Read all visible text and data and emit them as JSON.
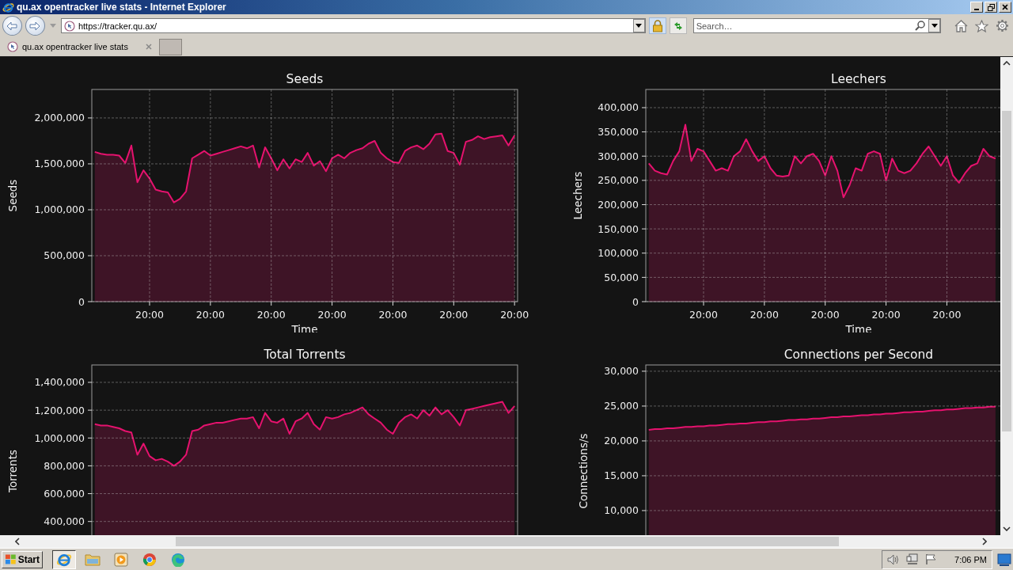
{
  "window": {
    "title": "qu.ax opentracker live stats - Internet Explorer"
  },
  "toolbar": {
    "address": "https://tracker.qu.ax/",
    "search_placeholder": "Search…"
  },
  "tabs": [
    {
      "label": "qu.ax opentracker live stats",
      "selected": true
    }
  ],
  "panels": [
    {
      "chart_data": {
        "type": "area",
        "title": "Seeds",
        "xlabel": "Time",
        "ylabel": "Seeds",
        "grid": true,
        "ylim": [
          0,
          2310000
        ],
        "categories": [
          null,
          null,
          null,
          null,
          null,
          null,
          null,
          null,
          null,
          "20:00",
          null,
          null,
          null,
          null,
          null,
          null,
          null,
          null,
          null,
          "20:00",
          null,
          null,
          null,
          null,
          null,
          null,
          null,
          null,
          null,
          "20:00",
          null,
          null,
          null,
          null,
          null,
          null,
          null,
          null,
          null,
          "20:00",
          null,
          null,
          null,
          null,
          null,
          null,
          null,
          null,
          null,
          "20:00",
          null,
          null,
          null,
          null,
          null,
          null,
          null,
          null,
          null,
          "20:00",
          null,
          null,
          null,
          null,
          null,
          null,
          null,
          null,
          null,
          "20:00"
        ],
        "series": [
          {
            "color": "#e6126e",
            "values": [
              1630000,
              1610000,
              1600000,
              1600000,
              1590000,
              1510000,
              1700000,
              1300000,
              1430000,
              1340000,
              1220000,
              1200000,
              1190000,
              1080000,
              1120000,
              1200000,
              1560000,
              1600000,
              1640000,
              1590000,
              1610000,
              1630000,
              1650000,
              1670000,
              1690000,
              1670000,
              1700000,
              1460000,
              1680000,
              1560000,
              1430000,
              1550000,
              1450000,
              1550000,
              1520000,
              1620000,
              1480000,
              1530000,
              1420000,
              1560000,
              1600000,
              1560000,
              1620000,
              1650000,
              1670000,
              1720000,
              1750000,
              1620000,
              1560000,
              1520000,
              1510000,
              1640000,
              1680000,
              1700000,
              1660000,
              1720000,
              1820000,
              1830000,
              1640000,
              1620000,
              1490000,
              1740000,
              1760000,
              1800000,
              1770000,
              1790000,
              1800000,
              1810000,
              1700000,
              1810000
            ]
          }
        ],
        "yticks": [
          {
            "value": 0,
            "label": "0"
          },
          {
            "value": 500000,
            "label": "500,000"
          },
          {
            "value": 1000000,
            "label": "1,000,000"
          },
          {
            "value": 1500000,
            "label": "1,500,000"
          },
          {
            "value": 2000000,
            "label": "2,000,000"
          }
        ]
      }
    },
    {
      "chart_data": {
        "type": "area",
        "title": "Leechers",
        "xlabel": "Time",
        "ylabel": "Leechers",
        "grid": true,
        "ylim": [
          0,
          437500
        ],
        "categories": [
          null,
          null,
          null,
          null,
          null,
          null,
          null,
          null,
          null,
          "20:00",
          null,
          null,
          null,
          null,
          null,
          null,
          null,
          null,
          null,
          "20:00",
          null,
          null,
          null,
          null,
          null,
          null,
          null,
          null,
          null,
          "20:00",
          null,
          null,
          null,
          null,
          null,
          null,
          null,
          null,
          null,
          "20:00",
          null,
          null,
          null,
          null,
          null,
          null,
          null,
          null,
          null,
          "20:00",
          null,
          null,
          null,
          null,
          null,
          null,
          null,
          null
        ],
        "series": [
          {
            "color": "#e6126e",
            "values": [
              285000,
              270000,
              265000,
              262000,
              290000,
              310000,
              365000,
              290000,
              315000,
              310000,
              290000,
              270000,
              275000,
              270000,
              300000,
              310000,
              335000,
              310000,
              290000,
              300000,
              275000,
              260000,
              258000,
              260000,
              300000,
              285000,
              300000,
              305000,
              290000,
              260000,
              300000,
              270000,
              215000,
              240000,
              275000,
              270000,
              305000,
              310000,
              305000,
              250000,
              295000,
              270000,
              265000,
              270000,
              285000,
              305000,
              320000,
              300000,
              280000,
              300000,
              260000,
              245000,
              265000,
              280000,
              285000,
              315000,
              300000,
              295000
            ]
          }
        ],
        "yticks": [
          {
            "value": 0,
            "label": "0"
          },
          {
            "value": 50000,
            "label": "50,000"
          },
          {
            "value": 100000,
            "label": "100,000"
          },
          {
            "value": 150000,
            "label": "150,000"
          },
          {
            "value": 200000,
            "label": "200,000"
          },
          {
            "value": 250000,
            "label": "250,000"
          },
          {
            "value": 300000,
            "label": "300,000"
          },
          {
            "value": 350000,
            "label": "350,000"
          },
          {
            "value": 400000,
            "label": "400,000"
          }
        ]
      }
    },
    {
      "chart_data": {
        "type": "area",
        "title": "Total Torrents",
        "ylabel": "Torrents",
        "grid": true,
        "ylim": [
          0,
          1525000
        ],
        "categories": [
          null,
          null,
          null,
          null,
          null,
          null,
          null,
          null,
          null,
          null,
          null,
          null,
          null,
          null,
          null,
          null,
          null,
          null,
          null,
          null,
          null,
          null,
          null,
          null,
          null,
          null,
          null,
          null,
          null,
          null,
          null,
          null,
          null,
          null,
          null,
          null,
          null,
          null,
          null,
          null,
          null,
          null,
          null,
          null,
          null,
          null,
          null,
          null,
          null,
          null,
          null,
          null,
          null,
          null,
          null,
          null,
          null,
          null,
          null,
          null,
          null,
          null,
          null,
          null,
          null,
          null,
          null,
          null,
          null,
          null
        ],
        "series": [
          {
            "color": "#e6126e",
            "values": [
              1100000,
              1090000,
              1090000,
              1080000,
              1070000,
              1050000,
              1040000,
              880000,
              960000,
              870000,
              840000,
              850000,
              830000,
              800000,
              830000,
              880000,
              1050000,
              1060000,
              1090000,
              1100000,
              1110000,
              1110000,
              1120000,
              1130000,
              1140000,
              1140000,
              1150000,
              1070000,
              1180000,
              1120000,
              1110000,
              1140000,
              1030000,
              1120000,
              1140000,
              1180000,
              1100000,
              1060000,
              1150000,
              1140000,
              1150000,
              1170000,
              1180000,
              1200000,
              1220000,
              1170000,
              1140000,
              1110000,
              1060000,
              1030000,
              1110000,
              1150000,
              1170000,
              1140000,
              1200000,
              1160000,
              1220000,
              1170000,
              1200000,
              1150000,
              1090000,
              1200000,
              1210000,
              1220000,
              1230000,
              1240000,
              1250000,
              1260000,
              1180000,
              1230000
            ]
          }
        ],
        "yticks": [
          {
            "value": 400000,
            "label": "400,000"
          },
          {
            "value": 600000,
            "label": "600,000"
          },
          {
            "value": 800000,
            "label": "800,000"
          },
          {
            "value": 1000000,
            "label": "1,000,000"
          },
          {
            "value": 1200000,
            "label": "1,200,000"
          },
          {
            "value": 1400000,
            "label": "1,400,000"
          }
        ]
      }
    },
    {
      "chart_data": {
        "type": "area",
        "title": "Connections per Second",
        "ylabel": "Connections/s",
        "grid": true,
        "ylim": [
          450,
          30900
        ],
        "categories": [
          null,
          null,
          null,
          null,
          null,
          null,
          null,
          null,
          null,
          null,
          null,
          null,
          null,
          null,
          null,
          null,
          null,
          null,
          null,
          null,
          null,
          null,
          null,
          null,
          null,
          null,
          null,
          null,
          null,
          null,
          null,
          null,
          null,
          null,
          null,
          null,
          null,
          null,
          null,
          null,
          null,
          null,
          null,
          null,
          null,
          null,
          null,
          null,
          null,
          null,
          null,
          null,
          null,
          null,
          null,
          null,
          null,
          null
        ],
        "series": [
          {
            "color": "#e6126e",
            "values": [
              21600,
              21700,
              21700,
              21800,
              21800,
              21900,
              22000,
              22000,
              22100,
              22100,
              22200,
              22200,
              22300,
              22400,
              22400,
              22500,
              22500,
              22600,
              22700,
              22700,
              22800,
              22800,
              22900,
              23000,
              23000,
              23100,
              23100,
              23200,
              23200,
              23300,
              23400,
              23400,
              23500,
              23500,
              23600,
              23700,
              23700,
              23800,
              23800,
              23900,
              23900,
              24000,
              24100,
              24100,
              24200,
              24200,
              24300,
              24400,
              24400,
              24500,
              24500,
              24600,
              24700,
              24700,
              24800,
              24800,
              24900,
              24900
            ]
          }
        ],
        "yticks": [
          {
            "value": 10000,
            "label": "10,000"
          },
          {
            "value": 15000,
            "label": "15,000"
          },
          {
            "value": 20000,
            "label": "20,000"
          },
          {
            "value": 25000,
            "label": "25,000"
          },
          {
            "value": 30000,
            "label": "30,000"
          }
        ]
      }
    }
  ],
  "taskbar": {
    "start": "Start",
    "apps": [
      {
        "selected": true
      },
      {
        "selected": false
      },
      {
        "selected": false
      },
      {
        "selected": false
      },
      {
        "selected": false
      }
    ],
    "clock": "7:06 PM"
  }
}
